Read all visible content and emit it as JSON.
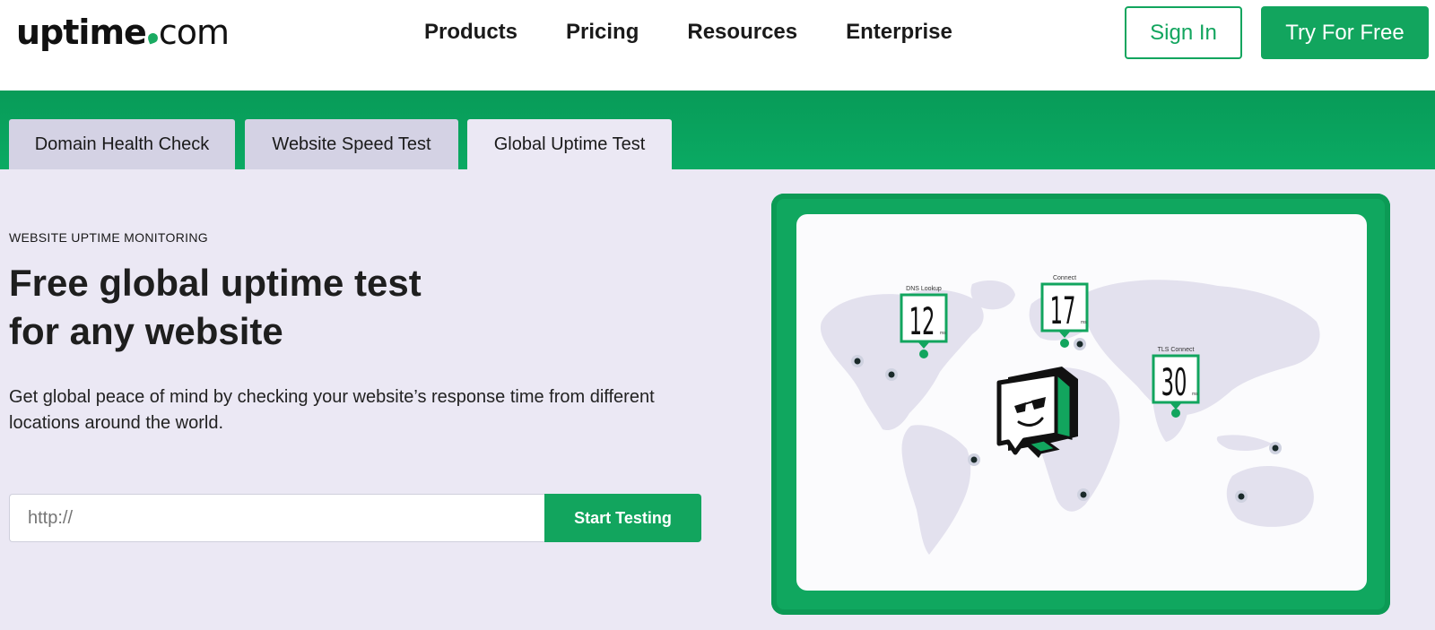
{
  "header": {
    "logo": {
      "brand": "uptime",
      "tld": "com"
    },
    "nav": [
      "Products",
      "Pricing",
      "Resources",
      "Enterprise"
    ],
    "sign_in": "Sign In",
    "try_free": "Try For Free"
  },
  "tabs": [
    "Domain Health Check",
    "Website Speed Test",
    "Global Uptime Test"
  ],
  "active_tab": "Global Uptime Test",
  "hero": {
    "eyebrow": "WEBSITE UPTIME MONITORING",
    "headline_line1": "Free global uptime test",
    "headline_line2": "for any website",
    "description": "Get global peace of mind by checking your website’s response time from different locations around the world.",
    "url_placeholder": "http://",
    "start_button": "Start Testing"
  },
  "illustration": {
    "metrics": [
      {
        "label": "DNS Lookup",
        "value": "12",
        "unit": "ms"
      },
      {
        "label": "Connect",
        "value": "17",
        "unit": "ms"
      },
      {
        "label": "TLS Connect",
        "value": "30",
        "unit": "ms"
      }
    ]
  },
  "colors": {
    "brand_green": "#12a55e",
    "tab_inactive": "#d4d2e4",
    "page_background": "#ebe8f4"
  }
}
